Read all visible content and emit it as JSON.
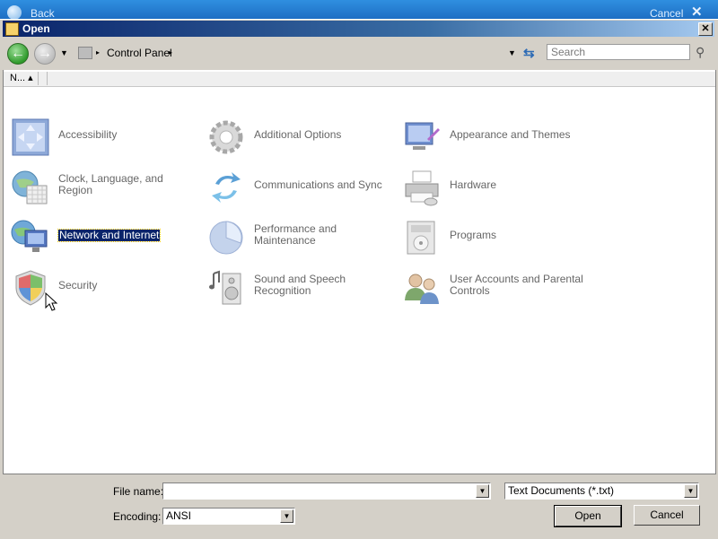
{
  "background_window": {
    "back_label": "Back",
    "cancel_label": "Cancel"
  },
  "titlebar": {
    "title": "Open"
  },
  "navigation": {
    "breadcrumb": "Control Panel",
    "search_placeholder": "Search"
  },
  "view": {
    "column_header": "N...",
    "items": [
      {
        "label": "Accessibility",
        "icon": "accessibility-icon"
      },
      {
        "label": "Additional Options",
        "icon": "gear-icon"
      },
      {
        "label": "Appearance and Themes",
        "icon": "appearance-icon"
      },
      {
        "label": "Clock, Language, and Region",
        "icon": "clock-globe-icon"
      },
      {
        "label": "Communications and Sync",
        "icon": "sync-arrows-icon"
      },
      {
        "label": "Hardware",
        "icon": "printer-icon"
      },
      {
        "label": "Network and Internet",
        "icon": "network-icon",
        "selected": true
      },
      {
        "label": "Performance and Maintenance",
        "icon": "pie-chart-icon"
      },
      {
        "label": "Programs",
        "icon": "programs-icon"
      },
      {
        "label": "Security",
        "icon": "shield-icon"
      },
      {
        "label": "Sound and Speech Recognition",
        "icon": "speaker-icon"
      },
      {
        "label": "User Accounts and Parental Controls",
        "icon": "users-icon"
      }
    ]
  },
  "form": {
    "file_name_label": "File name:",
    "file_name_value": "",
    "file_type_value": "Text Documents (*.txt)",
    "encoding_label": "Encoding:",
    "encoding_value": "ANSI",
    "open_label": "Open",
    "cancel_label": "Cancel"
  },
  "colors": {
    "selection": "#0a246a",
    "title_gradient_start": "#0a246a",
    "dialog_face": "#d4d0c8"
  }
}
